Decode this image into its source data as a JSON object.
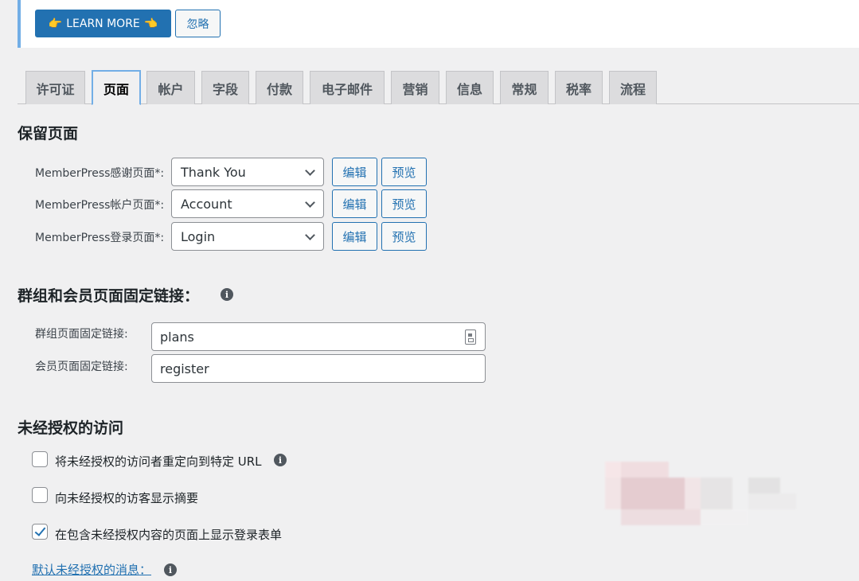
{
  "notice": {
    "learn_more_label": "LEARN MORE",
    "ignore_label": "忽略"
  },
  "tabs": [
    {
      "label": "许可证"
    },
    {
      "label": "页面",
      "active": true
    },
    {
      "label": "帐户"
    },
    {
      "label": "字段"
    },
    {
      "label": "付款"
    },
    {
      "label": "电子邮件"
    },
    {
      "label": "营销"
    },
    {
      "label": "信息"
    },
    {
      "label": "常规"
    },
    {
      "label": "税率"
    },
    {
      "label": "流程"
    }
  ],
  "reserved_pages": {
    "heading": "保留页面",
    "rows": [
      {
        "label": "MemberPress感谢页面*:",
        "value": "Thank You",
        "edit": "编辑",
        "preview": "预览"
      },
      {
        "label": "MemberPress帐户页面*:",
        "value": "Account",
        "edit": "编辑",
        "preview": "预览"
      },
      {
        "label": "MemberPress登录页面*:",
        "value": "Login",
        "edit": "编辑",
        "preview": "预览"
      }
    ]
  },
  "permalinks": {
    "heading": "群组和会员页面固定链接：",
    "group_label": "群组页面固定链接:",
    "group_value": "plans",
    "member_label": "会员页面固定链接:",
    "member_value": "register"
  },
  "unauthorized": {
    "heading": "未经授权的访问",
    "options": [
      {
        "label": "将未经授权的访问者重定向到特定 URL",
        "checked": false,
        "has_info": true
      },
      {
        "label": "向未经授权的访客显示摘要",
        "checked": false,
        "has_info": false
      },
      {
        "label": "在包含未经授权内容的页面上显示登录表单",
        "checked": true,
        "has_info": false
      }
    ],
    "default_message_link": "默认未经授权的消息："
  },
  "colors": {
    "accent": "#2271b1",
    "notice_border": "#72aee6",
    "background": "#f0f0f1"
  }
}
